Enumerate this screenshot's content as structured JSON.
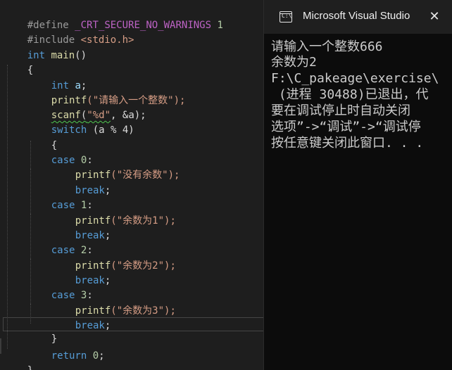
{
  "editor": {
    "lines": {
      "define_kw": "#define",
      "define_name": "_CRT_SECURE_NO_WARNINGS",
      "define_val": "1",
      "include_kw": "#include",
      "include_file": "<stdio.h>",
      "main_type": "int",
      "main_name": "main",
      "main_parens": "()",
      "brace_open": "{",
      "decl_type": "int",
      "decl_var": "a",
      "decl_end": ";",
      "printf1_fn": "printf",
      "printf1_str": "(\"请输入一个整数\");",
      "scanf_fn": "scanf",
      "scanf_open": "(",
      "scanf_fmt": "\"%d\"",
      "scanf_args": ", &a);",
      "switch_kw": "switch",
      "switch_expr": " (a % 4)",
      "switch_brace_open": "{",
      "case0_kw": "case",
      "case0_val": "0",
      "case0_colon": ":",
      "case0_printf": "printf",
      "case0_str": "(\"没有余数\");",
      "break0": "break",
      "case1_kw": "case",
      "case1_val": "1",
      "case1_colon": ":",
      "case1_printf": "printf",
      "case1_str": "(\"余数为1\");",
      "break1": "break",
      "case2_kw": "case",
      "case2_val": "2",
      "case2_colon": ":",
      "case2_printf": "printf",
      "case2_str": "(\"余数为2\");",
      "break2": "break",
      "case3_kw": "case",
      "case3_val": "3",
      "case3_colon": ":",
      "case3_printf": "printf",
      "case3_str": "(\"余数为3\");",
      "break3": "break",
      "semicolon": ";",
      "switch_brace_close": "}",
      "return_kw": "return",
      "return_val": "0",
      "brace_close": "}"
    }
  },
  "console": {
    "title": "Microsoft Visual Studio",
    "icon": "console-app-icon",
    "close_glyph": "✕",
    "output": [
      "请输入一个整数666",
      "余数为2",
      "F:\\C_pakeage\\exercise\\",
      " (进程 30488)已退出，代",
      "要在调试停止时自动关闭",
      "选项”->“调试”->“调试停",
      "按任意键关闭此窗口. . ."
    ]
  },
  "colors": {
    "editor_bg": "#1e1e1e",
    "keyword": "#569cd6",
    "function": "#dcdcaa",
    "string": "#d69d85",
    "number": "#b5cea8",
    "variable": "#9cdcfe",
    "macro": "#bd63c5",
    "preprocessor": "#9b9b9b",
    "console_bg": "#0c0c0c"
  }
}
